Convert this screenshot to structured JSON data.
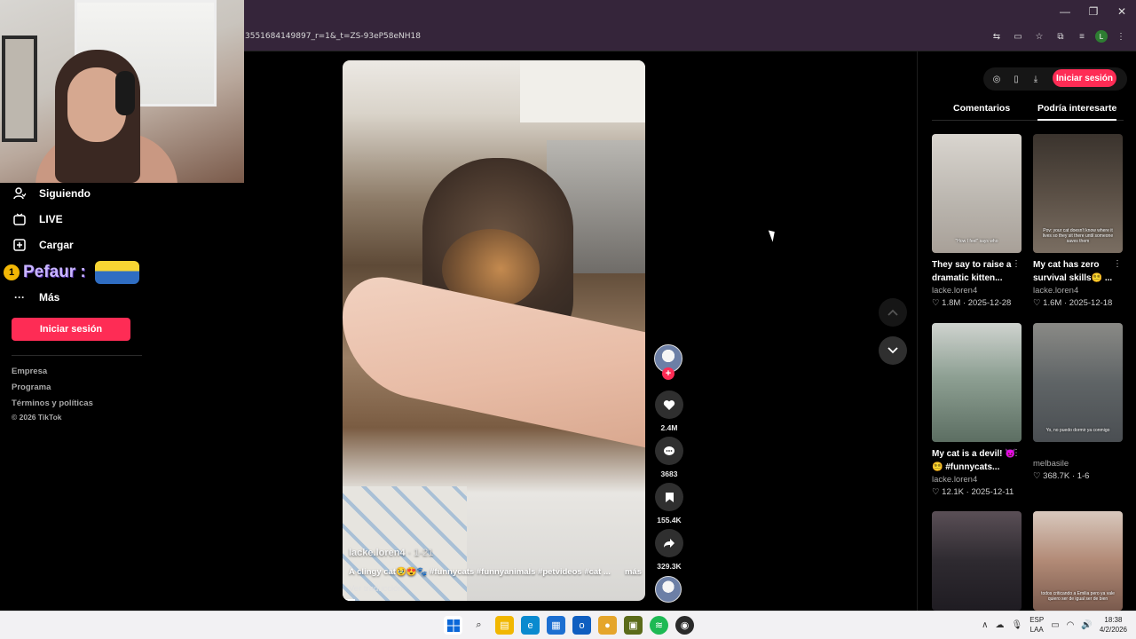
{
  "browser": {
    "url": "3551684149897_r=1&_t=ZS-93eP58eNH18",
    "window_controls": [
      "—",
      "❐",
      "✕"
    ],
    "profile_initial": "L"
  },
  "sidebar": {
    "items": [
      {
        "icon": "following-icon",
        "label": "Siguiendo"
      },
      {
        "icon": "live-icon",
        "label": "LIVE"
      },
      {
        "icon": "upload-icon",
        "label": "Cargar"
      },
      {
        "icon": "more-icon",
        "label": "Más"
      }
    ],
    "overlay_text": "Pefaur :",
    "overlay_badge": "1",
    "login_label": "Iniciar sesión",
    "footer_links": [
      "Empresa",
      "Programa",
      "Términos y políticas",
      "© 2026 TikTok"
    ]
  },
  "video": {
    "author": "lacke.loren4",
    "date": "· 1-21",
    "caption": "A clingy cat🥹😍🐾 #funnycats #funnyanimals #petvideos #cat ...",
    "more_label": "más",
    "translate_label": "Ver traducción",
    "progress": 0.04
  },
  "actions": {
    "likes": "2.4M",
    "comments": "3683",
    "saves": "155.4K",
    "shares": "329.3K"
  },
  "right_panel": {
    "login_label": "Iniciar sesión",
    "tabs": [
      "Comentarios",
      "Podría interesarte"
    ],
    "active_tab": "Podría interesarte",
    "cards": [
      {
        "title": "They say to raise a dramatic kitten...",
        "author": "lacke.loren4",
        "likes": "1.8M",
        "date": "2025-12-28",
        "overlay": "\"How I feel\" says who"
      },
      {
        "title": "My cat has zero survival skills😵‍💫 ...",
        "author": "lacke.loren4",
        "likes": "1.6M",
        "date": "2025-12-18",
        "overlay": "Pov: your cat doesn't know where it lives so they sit there until someone saves them"
      },
      {
        "title": "My cat is a devil! 👿😵‍💫 #funnycats...",
        "author": "lacke.loren4",
        "likes": "12.1K",
        "date": "2025-12-11",
        "overlay": ""
      },
      {
        "title": "",
        "author": "melbasile",
        "likes": "368.7K",
        "date": "1-6",
        "overlay": "Yo, no puedo dormir ya conmigo"
      },
      {
        "title": "",
        "author": "",
        "likes": "",
        "date": "",
        "overlay": ""
      },
      {
        "title": "",
        "author": "",
        "likes": "",
        "date": "",
        "overlay": "todos criticando a Emilia pero ya vale quiero ser de igual ser de bien"
      }
    ]
  },
  "taskbar": {
    "lang_top": "ESP",
    "lang_bottom": "LAA",
    "time": "18:38",
    "date": "4/2/2026"
  },
  "colors": {
    "accent": "#fe2c55",
    "browser_frame": "#35253a",
    "taskbar": "#f2f1f3"
  }
}
